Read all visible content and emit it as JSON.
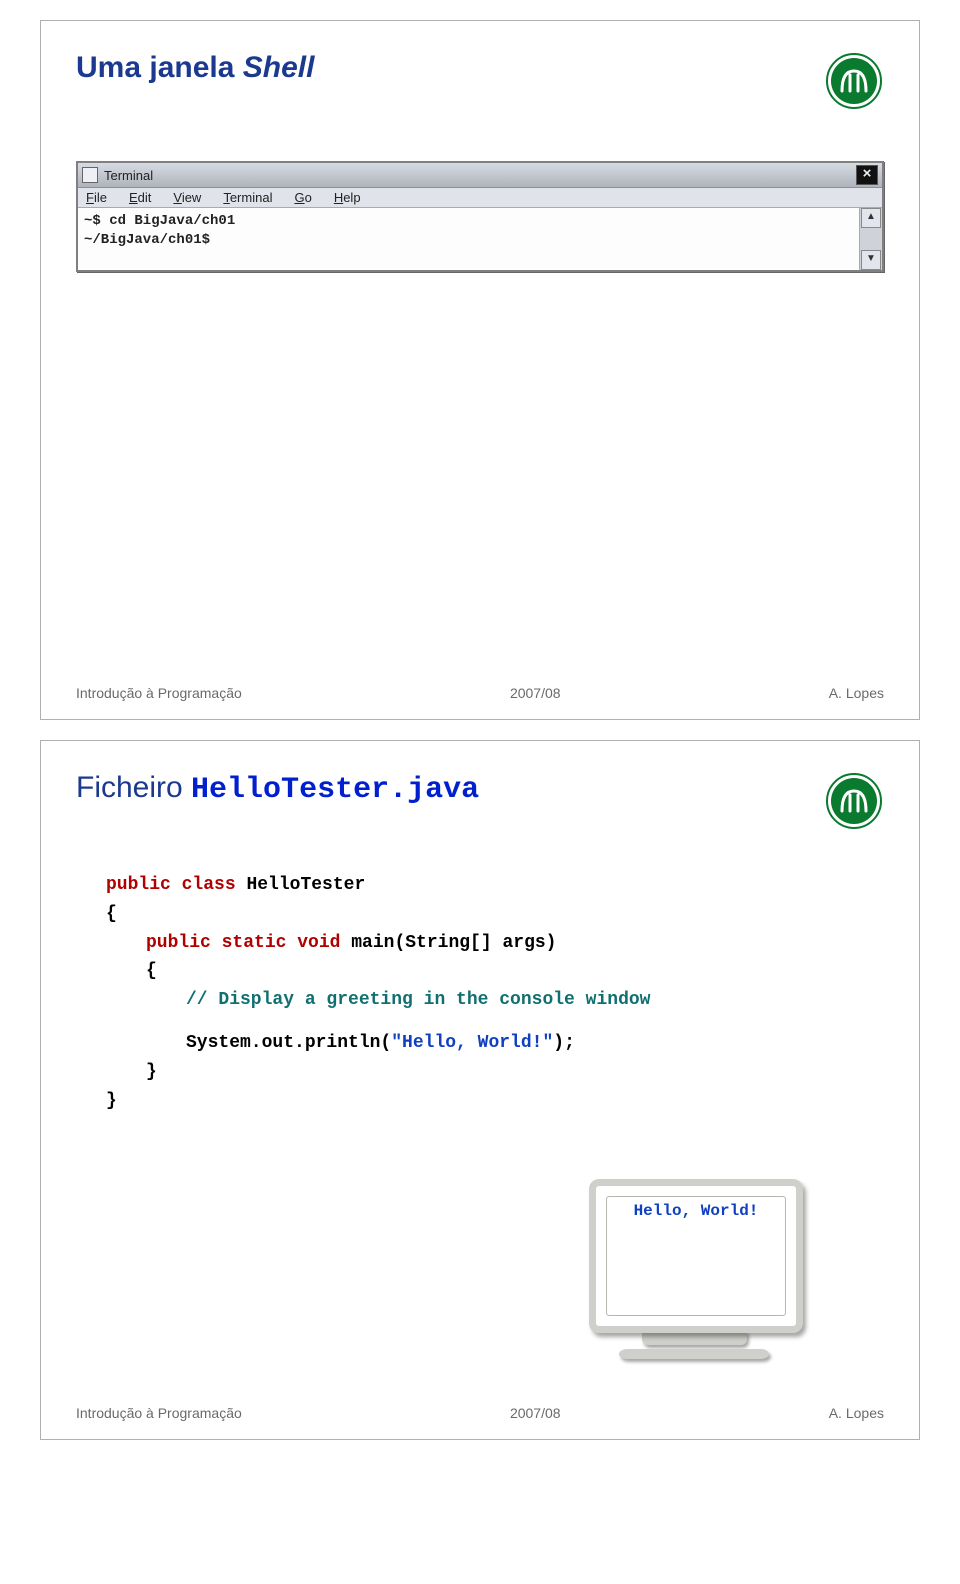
{
  "slide1": {
    "title_prefix": "Uma janela ",
    "title_italic": "Shell",
    "terminal": {
      "window_title": "Terminal",
      "close_glyph": "×",
      "menu": {
        "file": "File",
        "edit": "Edit",
        "view": "View",
        "terminal": "Terminal",
        "go": "Go",
        "help": "Help"
      },
      "content_line1": "~$ cd BigJava/ch01",
      "content_line2": "~/BigJava/ch01$",
      "scroll_up": "▲",
      "scroll_down": "▼"
    }
  },
  "slide2": {
    "title_text": "Ficheiro ",
    "title_mono": "HelloTester.java",
    "code": {
      "l1_a": "public class ",
      "l1_b": "HelloTester",
      "l2": "{",
      "l3_a": "public static void ",
      "l3_b": "main(String[] args)",
      "l4": "{",
      "l5": "// Display a greeting in the console window",
      "l6_a": "System.out.println(",
      "l6_b": "\"Hello, World!\"",
      "l6_c": ");",
      "l7": "}",
      "l8": "}"
    },
    "monitor_output": "Hello, World!"
  },
  "footer": {
    "left": "Introdução à Programação",
    "center": "2007/08",
    "right": "A. Lopes"
  },
  "logo_label": "Universidade Nova de Lisboa"
}
